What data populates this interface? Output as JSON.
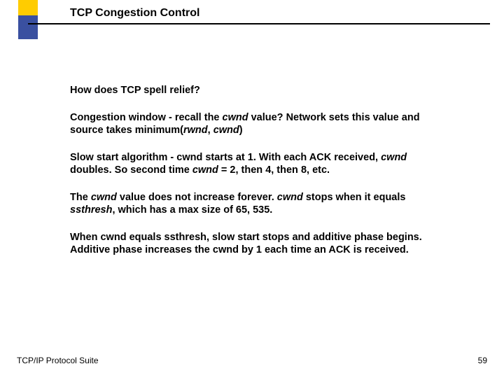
{
  "slide": {
    "title": "TCP Congestion Control",
    "heading": "How does TCP spell relief?",
    "p1_a": "Congestion window - recall the ",
    "p1_cwnd": "cwnd",
    "p1_b": " value?  Network sets this value and source takes minimum(",
    "p1_rwnd": "rwnd",
    "p1_c": ", ",
    "p1_cwnd2": "cwnd",
    "p1_d": ")",
    "p2_a": "Slow start algorithm - cwnd starts at 1.  With each ACK received, ",
    "p2_cwnd": "cwnd",
    "p2_b": " doubles.  So second time ",
    "p2_cwnd2": "cwnd",
    "p2_c": " = 2, then 4, then 8, etc.",
    "p3_a": "The ",
    "p3_cwnd": "cwnd",
    "p3_b": " value does not increase forever.  ",
    "p3_cwnd2": "cwnd",
    "p3_c": " stops when it equals ",
    "p3_ssthresh": "ssthresh",
    "p3_d": ", which has a max size of 65, 535.",
    "p4": "When cwnd equals ssthresh, slow start stops and additive phase begins.  Additive phase increases the cwnd by 1 each time an ACK is received.",
    "footer_left": "TCP/IP Protocol Suite",
    "page_number": "59"
  }
}
